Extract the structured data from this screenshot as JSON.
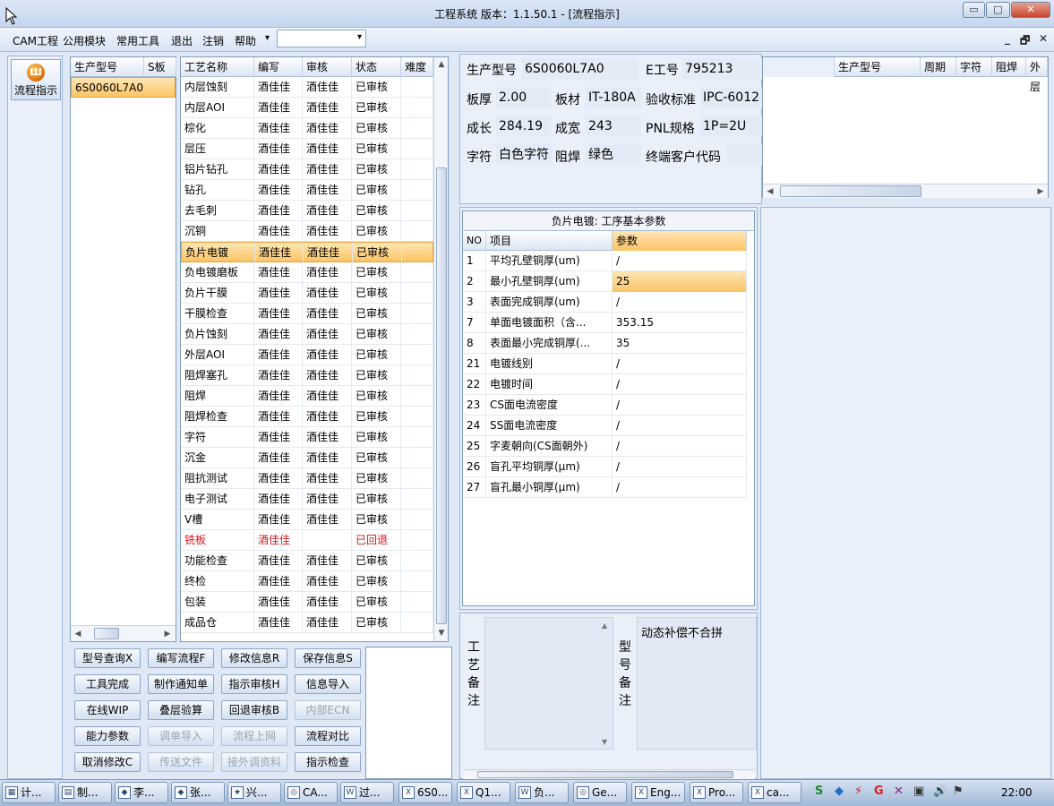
{
  "window": {
    "title": "工程系统  版本：1.1.50.1 - [流程指示]",
    "min": "▭",
    "max": "□",
    "close": "✕"
  },
  "menu": {
    "items": [
      "CAM工程",
      "公用模块",
      "常用工具",
      "退出",
      "注销",
      "帮助"
    ],
    "help_arrow": "▾",
    "combo_value": "",
    "combo_arrow": "▾"
  },
  "mdi": {
    "minimize": "_",
    "restore": "🗗",
    "close": "✕"
  },
  "nav": {
    "button_label": "流程指示",
    "icon_glyph": "Ш"
  },
  "model_list": {
    "headers": [
      "生产型号",
      "S板"
    ],
    "rows": [
      "6S0060L7A0"
    ]
  },
  "process_grid": {
    "headers": [
      "工艺名称",
      "编写",
      "审核",
      "状态",
      "难度"
    ],
    "rows": [
      [
        "内层蚀刻",
        "酒佳佳",
        "酒佳佳",
        "已审核",
        ""
      ],
      [
        "内层AOI",
        "酒佳佳",
        "酒佳佳",
        "已审核",
        ""
      ],
      [
        "棕化",
        "酒佳佳",
        "酒佳佳",
        "已审核",
        ""
      ],
      [
        "层压",
        "酒佳佳",
        "酒佳佳",
        "已审核",
        ""
      ],
      [
        "铝片钻孔",
        "酒佳佳",
        "酒佳佳",
        "已审核",
        ""
      ],
      [
        "钻孔",
        "酒佳佳",
        "酒佳佳",
        "已审核",
        ""
      ],
      [
        "去毛刺",
        "酒佳佳",
        "酒佳佳",
        "已审核",
        ""
      ],
      [
        "沉铜",
        "酒佳佳",
        "酒佳佳",
        "已审核",
        ""
      ],
      [
        "负片电镀",
        "酒佳佳",
        "酒佳佳",
        "已审核",
        ""
      ],
      [
        "负电镀磨板",
        "酒佳佳",
        "酒佳佳",
        "已审核",
        ""
      ],
      [
        "负片干膜",
        "酒佳佳",
        "酒佳佳",
        "已审核",
        ""
      ],
      [
        "干膜检查",
        "酒佳佳",
        "酒佳佳",
        "已审核",
        ""
      ],
      [
        "负片蚀刻",
        "酒佳佳",
        "酒佳佳",
        "已审核",
        ""
      ],
      [
        "外层AOI",
        "酒佳佳",
        "酒佳佳",
        "已审核",
        ""
      ],
      [
        "阻焊塞孔",
        "酒佳佳",
        "酒佳佳",
        "已审核",
        ""
      ],
      [
        "阻焊",
        "酒佳佳",
        "酒佳佳",
        "已审核",
        ""
      ],
      [
        "阻焊检查",
        "酒佳佳",
        "酒佳佳",
        "已审核",
        ""
      ],
      [
        "字符",
        "酒佳佳",
        "酒佳佳",
        "已审核",
        ""
      ],
      [
        "沉金",
        "酒佳佳",
        "酒佳佳",
        "已审核",
        ""
      ],
      [
        "阻抗测试",
        "酒佳佳",
        "酒佳佳",
        "已审核",
        ""
      ],
      [
        "电子测试",
        "酒佳佳",
        "酒佳佳",
        "已审核",
        ""
      ],
      [
        "V槽",
        "酒佳佳",
        "酒佳佳",
        "已审核",
        ""
      ],
      [
        "铣板",
        "酒佳佳",
        "",
        "已回退",
        ""
      ],
      [
        "功能检查",
        "酒佳佳",
        "酒佳佳",
        "已审核",
        ""
      ],
      [
        "终检",
        "酒佳佳",
        "酒佳佳",
        "已审核",
        ""
      ],
      [
        "包装",
        "酒佳佳",
        "酒佳佳",
        "已审核",
        ""
      ],
      [
        "成品仓",
        "酒佳佳",
        "酒佳佳",
        "已审核",
        ""
      ]
    ],
    "selected_row": 8,
    "returned_row": 22,
    "returned_color": "#d4161b"
  },
  "buttons": [
    [
      "型号查询X",
      "编写流程F",
      "修改信息R",
      "保存信息S"
    ],
    [
      "工具完成",
      "制作通知单",
      "指示审核H",
      "信息导入"
    ],
    [
      "在线WIP",
      "叠层验算",
      "回退审核B",
      "内部ECN"
    ],
    [
      "能力参数",
      "调单导入",
      "流程上网",
      "流程对比"
    ],
    [
      "取消修改C",
      "传送文件",
      "接外调资料",
      "指示检查"
    ]
  ],
  "disabled_buttons": [
    "内部ECN",
    "调单导入",
    "流程上网",
    "传送文件",
    "接外调资料"
  ],
  "info": {
    "model_label": "生产型号",
    "model": "6S0060L7A0",
    "eno_label": "E工号",
    "eno": "795213",
    "thickness_label": "板厚",
    "thickness": "2.00",
    "material_label": "板材",
    "material": "IT-180A",
    "standard_label": "验收标准",
    "standard": "IPC-6012",
    "length_label": "成长",
    "length": "284.19",
    "width_label": "成宽",
    "width": "243",
    "pnl_label": "PNL规格",
    "pnl": "1P=2U",
    "silk_label": "字符",
    "silk": "白色字符",
    "mask_label": "阻焊",
    "mask": "绿色",
    "customer_label": "终端客户代码",
    "customer": ""
  },
  "right_grid": {
    "headers": [
      "",
      "生产型号",
      "周期",
      "字符",
      "阻焊",
      "外层"
    ]
  },
  "params": {
    "title": "负片电镀: 工序基本参数",
    "headers": [
      "NO",
      "项目",
      "参数"
    ],
    "rows": [
      [
        "1",
        "平均孔壁铜厚(um)",
        "/"
      ],
      [
        "2",
        "最小孔壁铜厚(um)",
        "25"
      ],
      [
        "3",
        "表面完成铜厚(um)",
        "/"
      ],
      [
        "7",
        "单面电镀面积（含...",
        "353.15"
      ],
      [
        "8",
        "表面最小完成铜厚(...",
        "35"
      ],
      [
        "21",
        "电镀线别",
        "/"
      ],
      [
        "22",
        "电镀时间",
        "/"
      ],
      [
        "23",
        "CS面电流密度",
        "/"
      ],
      [
        "24",
        "SS面电流密度",
        "/"
      ],
      [
        "25",
        "字麦朝向(CS面朝外)",
        "/"
      ],
      [
        "26",
        "盲孔平均铜厚(μm)",
        "/"
      ],
      [
        "27",
        "盲孔最小铜厚(μm)",
        "/"
      ]
    ],
    "selected_row": 1
  },
  "remarks": {
    "process_label": [
      "工",
      "艺",
      "备",
      "注"
    ],
    "process_text": "",
    "model_label": [
      "型",
      "号",
      "备",
      "注"
    ],
    "model_text": "动态补偿不合拼"
  },
  "taskbar": {
    "tasks": [
      {
        "label": "计...",
        "icon": "▦"
      },
      {
        "label": "制...",
        "icon": "▤"
      },
      {
        "label": "李...",
        "icon": "◆"
      },
      {
        "label": "张...",
        "icon": "◆"
      },
      {
        "label": "兴...",
        "icon": "★"
      },
      {
        "label": "CA...",
        "icon": "◎"
      },
      {
        "label": "过...",
        "icon": "W"
      },
      {
        "label": "6S0...",
        "icon": "X"
      },
      {
        "label": "Q1...",
        "icon": "X"
      },
      {
        "label": "负...",
        "icon": "W"
      },
      {
        "label": "Ge...",
        "icon": "◎"
      },
      {
        "label": "Eng...",
        "icon": "X"
      },
      {
        "label": "Pro...",
        "icon": "X"
      },
      {
        "label": "ca...",
        "icon": "X"
      }
    ],
    "tray_icons": [
      "S",
      "◆",
      "⚡",
      "G",
      "✕",
      "▣",
      "🔊",
      "⚑"
    ],
    "clock": "22:00"
  }
}
